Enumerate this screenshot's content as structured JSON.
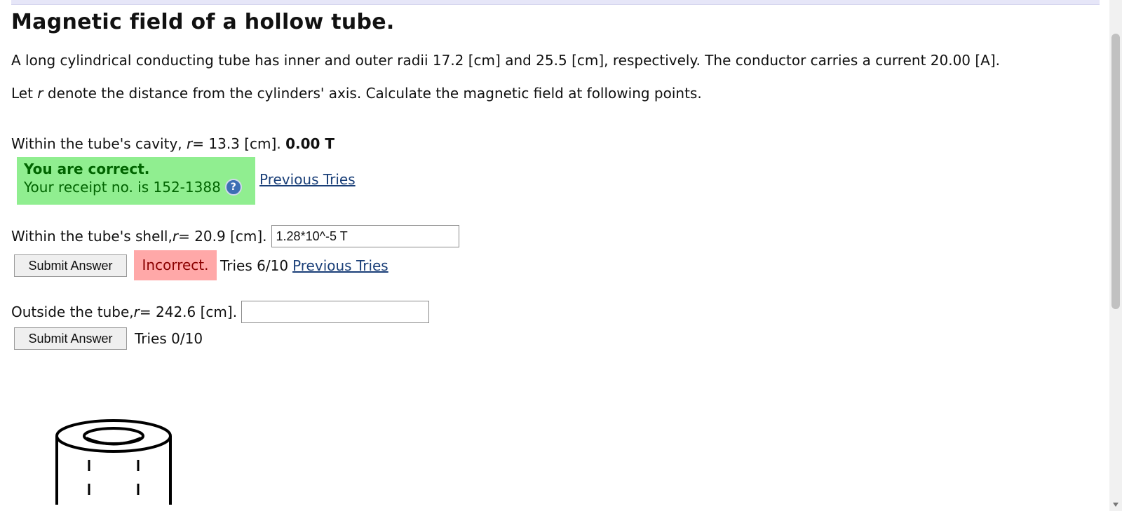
{
  "title": "Magnetic field of a hollow tube.",
  "intro": "A long cylindrical conducting tube has inner and outer radii 17.2 [cm] and 25.5 [cm], respectively. The conductor carries a current 20.00 [A].",
  "instruction": {
    "before": "Let ",
    "var": "r",
    "after": " denote the distance from the cylinders' axis. Calculate the magnetic field at following points."
  },
  "q1": {
    "prefix": "Within the tube's cavity, ",
    "var": "r",
    "suffix": "= 13.3 [cm]. ",
    "answer": "0.00 T",
    "status_title": "You are correct.",
    "receipt": "Your receipt no. is 152-1388",
    "help_icon": "question-circle-icon",
    "previous_tries": "Previous Tries"
  },
  "q2": {
    "prefix": "Within the tube's shell, ",
    "var": "r",
    "suffix": "= 20.9 [cm].",
    "input_value": "1.28*10^-5 T",
    "submit_label": "Submit Answer",
    "status": "Incorrect.",
    "tries": "Tries 6/10",
    "previous_tries": "Previous Tries"
  },
  "q3": {
    "prefix": "Outside the tube, ",
    "var": "r",
    "suffix": "= 242.6 [cm].",
    "input_value": "",
    "submit_label": "Submit Answer",
    "tries": "Tries 0/10"
  },
  "colors": {
    "correct_bg": "#90ee90",
    "incorrect_bg": "#ffa8a8",
    "link": "#1a3f78"
  }
}
